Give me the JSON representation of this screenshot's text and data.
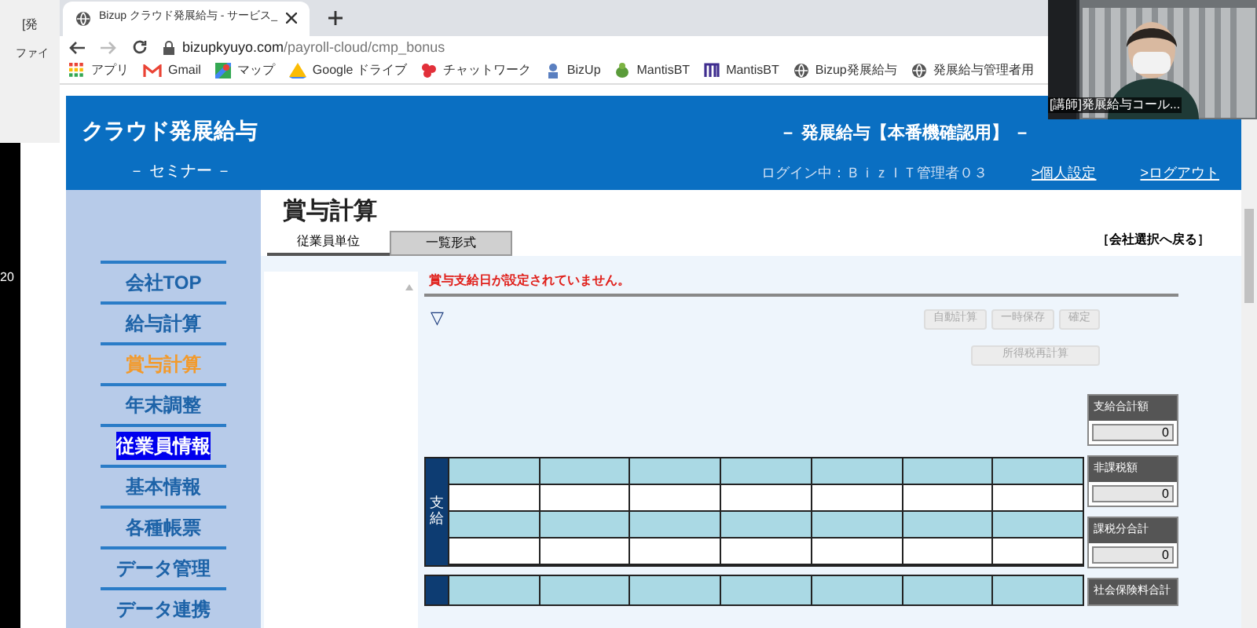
{
  "background_window": {
    "fragments": [
      "[発",
      "ファイ",
      "20"
    ]
  },
  "browser": {
    "tab_title": "Bizup クラウド発展給与 - サービス_",
    "url_host": "bizupkyuyo.com",
    "url_path": "/payroll-cloud/cmp_bonus",
    "bookmarks": [
      {
        "label": "アプリ",
        "kind": "apps"
      },
      {
        "label": "Gmail",
        "kind": "mail"
      },
      {
        "label": "マップ",
        "kind": "map"
      },
      {
        "label": "Google ドライブ",
        "kind": "drive"
      },
      {
        "label": "チャットワーク",
        "kind": "chat"
      },
      {
        "label": "BizUp",
        "kind": "bizup"
      },
      {
        "label": "MantisBT",
        "kind": "mantis"
      },
      {
        "label": "MantisBT",
        "kind": "m"
      },
      {
        "label": "Bizup発展給与",
        "kind": "globe"
      },
      {
        "label": "発展給与管理者用",
        "kind": "globe"
      }
    ]
  },
  "webcam": {
    "caption": "[講師]発展給与コール..."
  },
  "header": {
    "logo": "クラウド発展給与",
    "subtitle": "－ セミナー －",
    "environment": "－ 発展給与【本番機確認用】 －",
    "login": "ログイン中：ＢｉｚＩＴ管理者０３",
    "links": [
      ">個人設定",
      ">ログアウト"
    ]
  },
  "sidebar": {
    "items": [
      {
        "label": "会社TOP",
        "selected": false,
        "highlighted": false
      },
      {
        "label": "給与計算",
        "selected": false,
        "highlighted": false
      },
      {
        "label": "賞与計算",
        "selected": true,
        "highlighted": false
      },
      {
        "label": "年末調整",
        "selected": false,
        "highlighted": false
      },
      {
        "label": "従業員情報",
        "selected": false,
        "highlighted": true
      },
      {
        "label": "基本情報",
        "selected": false,
        "highlighted": false
      },
      {
        "label": "各種帳票",
        "selected": false,
        "highlighted": false
      },
      {
        "label": "データ管理",
        "selected": false,
        "highlighted": false
      },
      {
        "label": "データ連携",
        "selected": false,
        "highlighted": false
      }
    ]
  },
  "main": {
    "title": "賞与計算",
    "back_link": "［会社選択へ戻る］",
    "tabs": [
      {
        "label": "従業員単位",
        "selected": true
      },
      {
        "label": "一覧形式",
        "selected": false
      }
    ],
    "error": "賞与支給日が設定されていません。",
    "toggle": "▽",
    "buttons": [
      {
        "label": "自動計算",
        "disabled": true
      },
      {
        "label": "一時保存",
        "disabled": true
      },
      {
        "label": "確定",
        "disabled": true
      }
    ],
    "recalc_button": {
      "label": "所得税再計算",
      "disabled": true
    },
    "grid_label": "支給",
    "totals": [
      {
        "label": "支給合計額",
        "value": "0"
      },
      {
        "label": "非課税額",
        "value": "0"
      },
      {
        "label": "課税分合計",
        "value": "0"
      },
      {
        "label": "社会保険料合計"
      }
    ]
  }
}
